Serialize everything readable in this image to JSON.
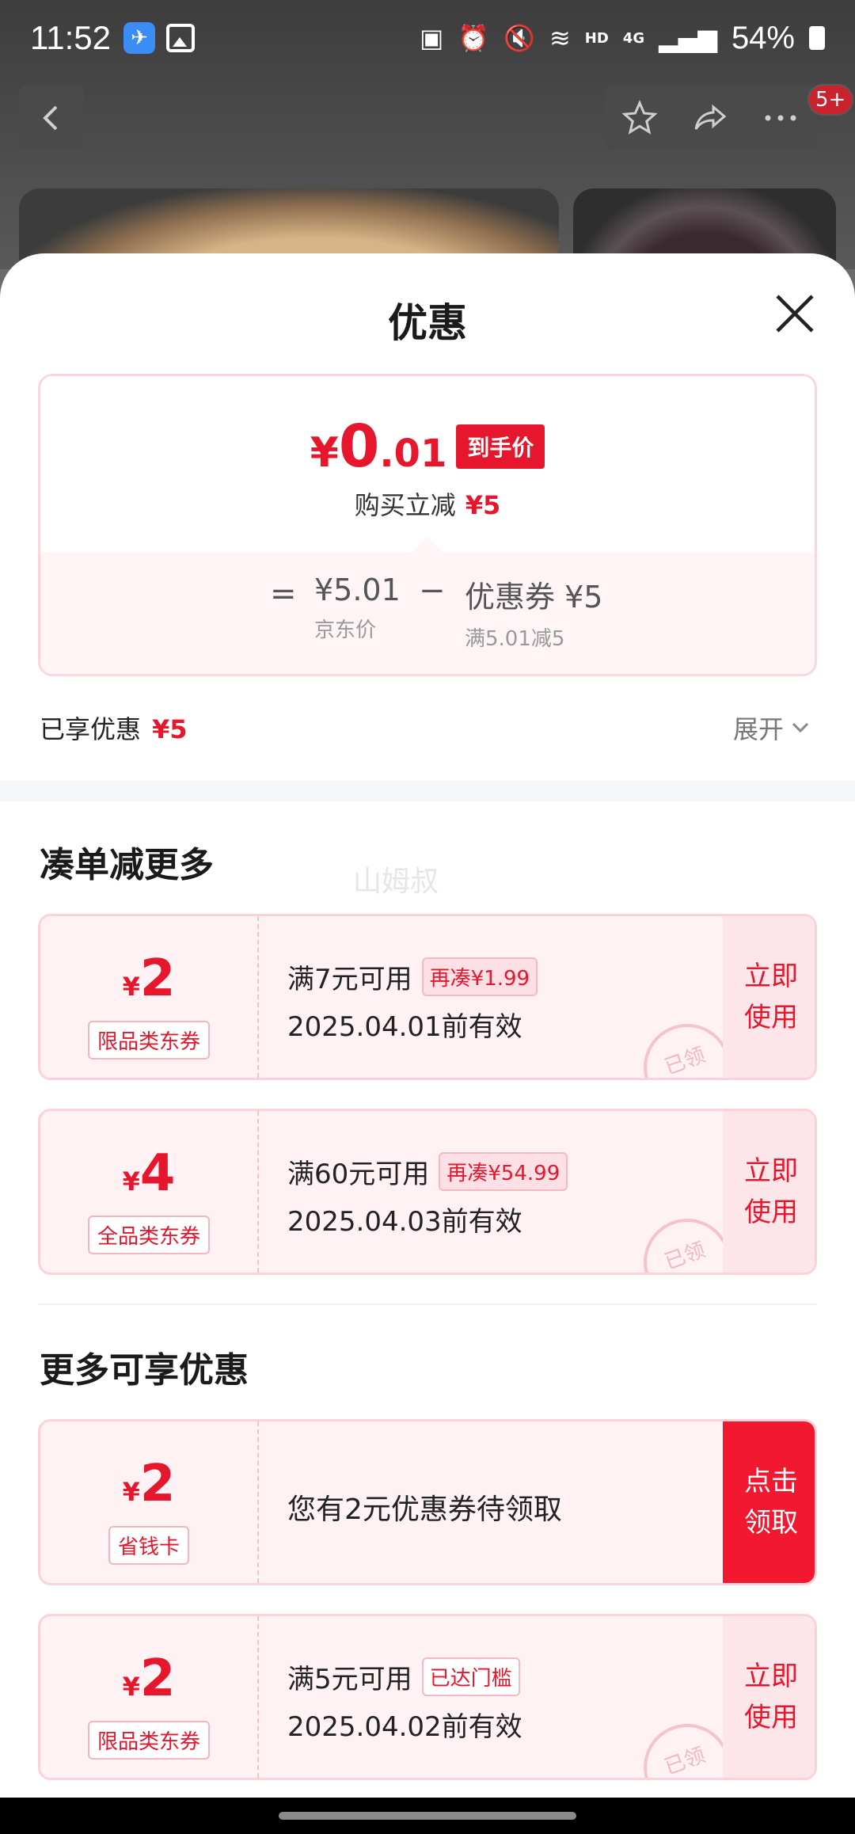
{
  "status_bar": {
    "time": "11:52",
    "network_hd": "HD",
    "network_4g": "4G",
    "battery": "54%"
  },
  "nav": {
    "message_badge": "5+"
  },
  "sheet": {
    "title": "优惠",
    "price": {
      "currency": "¥",
      "integer": "0",
      "decimal": ".01",
      "tag": "到手价",
      "instant_label": "购买立减",
      "instant_value": "¥5"
    },
    "breakdown": {
      "equals": "=",
      "jd_price": "¥5.01",
      "jd_price_label": "京东价",
      "minus": "−",
      "coupon": "优惠券 ¥5",
      "coupon_rule": "满5.01减5"
    },
    "enjoyed_label": "已享优惠",
    "enjoyed_value": "¥5",
    "expand_label": "展开",
    "watermark": "山姆叔",
    "section_more_order": "凑单减更多",
    "section_more_benefits": "更多可享优惠",
    "coupons": [
      {
        "currency": "¥",
        "amount": "2",
        "type": "限品类东券",
        "condition": "满7元可用",
        "chip": "再凑¥1.99",
        "date": "2025.04.01前有效",
        "action": "立即使用",
        "stamp": "已领"
      },
      {
        "currency": "¥",
        "amount": "4",
        "type": "全品类东券",
        "condition": "满60元可用",
        "chip": "再凑¥54.99",
        "date": "2025.04.03前有效",
        "action": "立即使用",
        "stamp": "已领"
      },
      {
        "currency": "¥",
        "amount": "2",
        "type": "省钱卡",
        "text": "您有2元优惠券待领取",
        "action": "点击领取"
      },
      {
        "currency": "¥",
        "amount": "2",
        "type": "限品类东券",
        "condition": "满5元可用",
        "chip": "已达门槛",
        "date": "2025.04.02前有效",
        "action": "立即使用",
        "stamp": "已领"
      }
    ]
  },
  "colors": {
    "accent_red": "#e6162c",
    "coupon_bg": "#fff2f4",
    "coupon_border": "#fbd2d9"
  }
}
